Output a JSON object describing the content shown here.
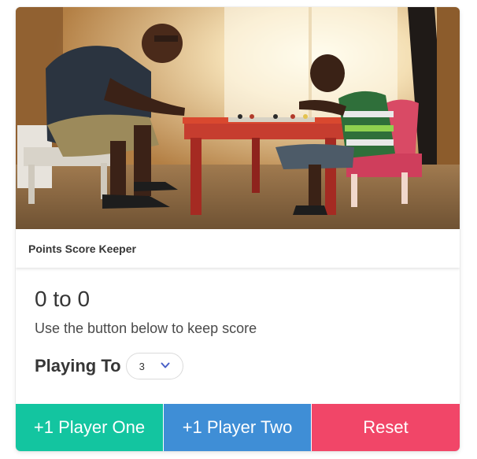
{
  "card": {
    "header_title": "Points Score Keeper"
  },
  "scoreboard": {
    "player_one_score": "0",
    "separator": "to",
    "player_two_score": "0",
    "instruction": "Use the button below to keep score"
  },
  "playing_to": {
    "label": "Playing To",
    "selected": "3"
  },
  "footer": {
    "player_one_label": "+1 Player One",
    "player_two_label": "+1 Player Two",
    "reset_label": "Reset"
  },
  "colors": {
    "player_one": "#13c5a0",
    "player_two": "#3f8ed6",
    "reset": "#f14668",
    "chevron": "#485fc7"
  },
  "image": {
    "icon": "photo-father-son-playing-game"
  }
}
